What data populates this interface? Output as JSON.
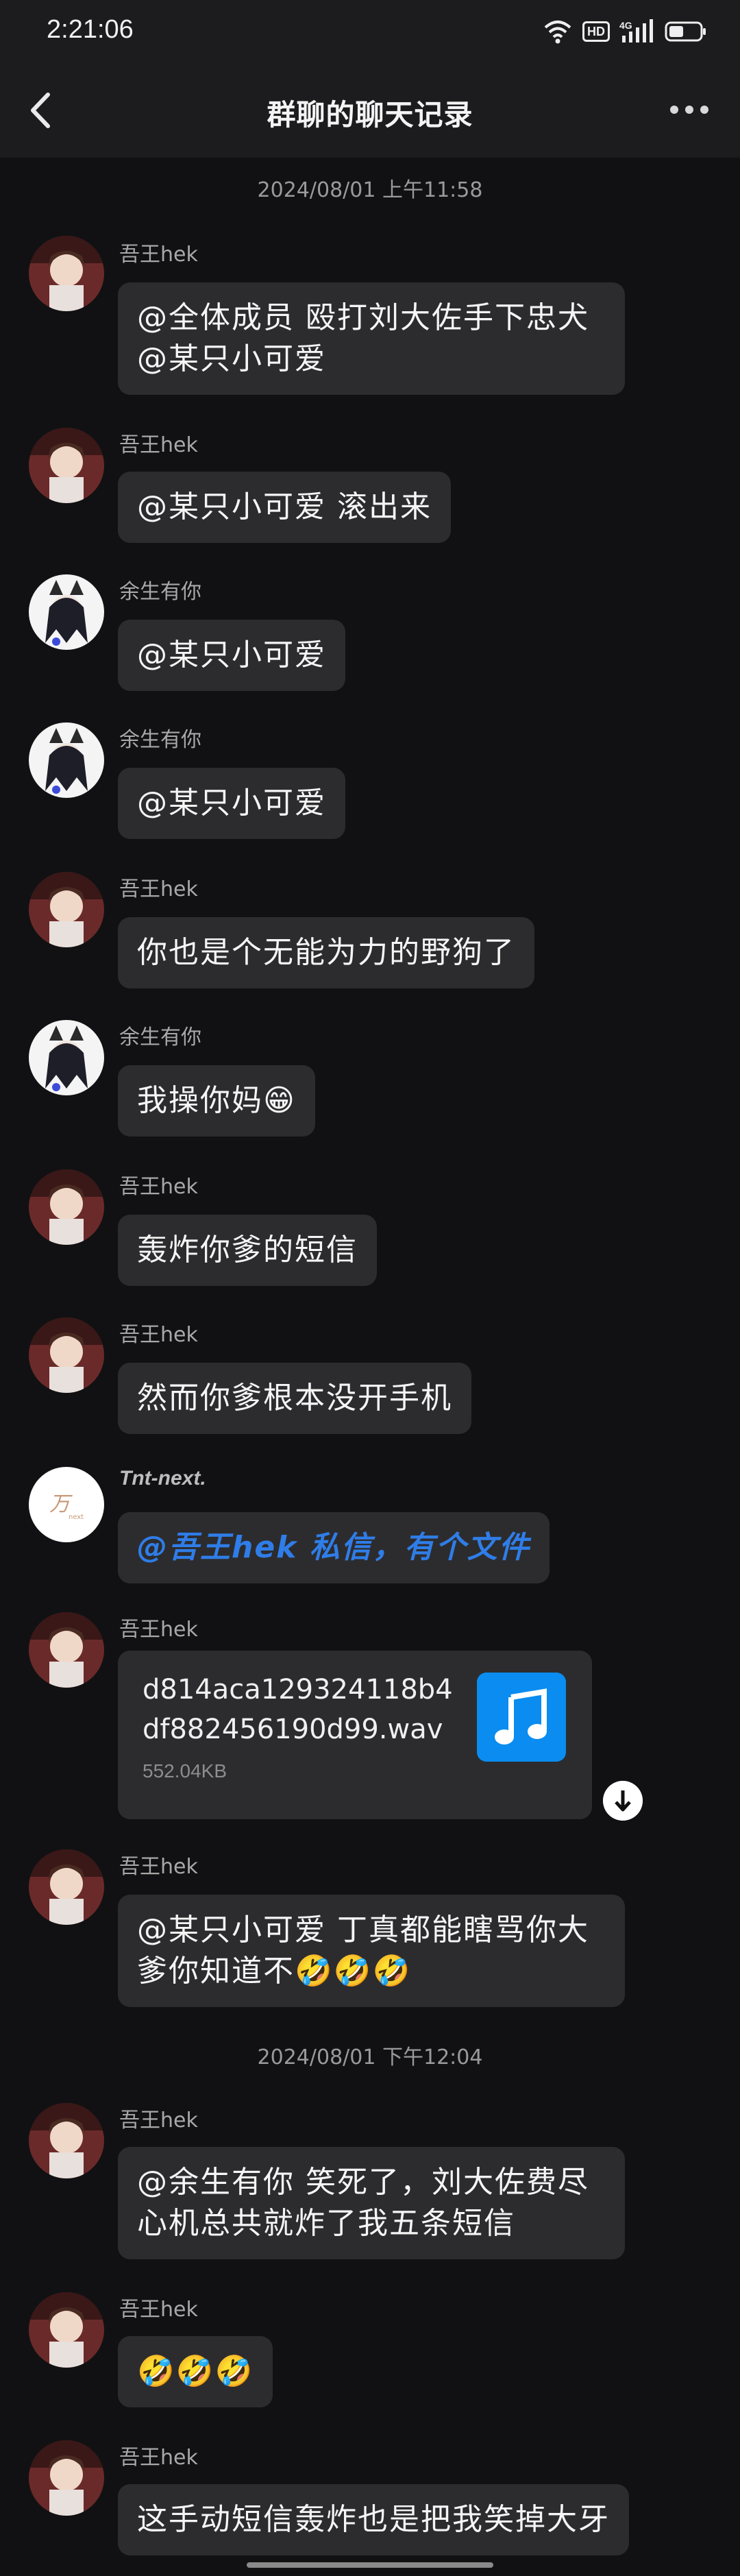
{
  "status_bar": {
    "time": "2:21:06",
    "hd_label": "HD",
    "network_label": "4G"
  },
  "nav": {
    "title": "群聊的聊天记录"
  },
  "timestamps": [
    "2024/08/01 上午11:58",
    "2024/08/01 下午12:04"
  ],
  "messages": [
    {
      "sender": "吾王hek",
      "text": "@全体成员 殴打刘大佐手下忠犬@某只小可爱"
    },
    {
      "sender": "吾王hek",
      "text": "@某只小可爱 滚出来"
    },
    {
      "sender": "余生有你",
      "text": "@某只小可爱"
    },
    {
      "sender": "余生有你",
      "text": "@某只小可爱"
    },
    {
      "sender": "吾王hek",
      "text": "你也是个无能为力的野狗了"
    },
    {
      "sender": "余生有你",
      "text": "我操你妈😁"
    },
    {
      "sender": "吾王hek",
      "text": "轰炸你爹的短信"
    },
    {
      "sender": "吾王hek",
      "text": "然而你爹根本没开手机"
    },
    {
      "sender": "Tnt-next.",
      "text": "@吾王hek 私信，有个文件"
    },
    {
      "sender": "吾王hek",
      "file_name": "d814aca129324118b4df882456190d99.wav",
      "file_size": "552.04KB"
    },
    {
      "sender": "吾王hek",
      "text": "@某只小可爱 丁真都能瞎骂你大爹你知道不🤣🤣🤣"
    },
    {
      "sender": "吾王hek",
      "text": "@余生有你 笑死了，刘大佐费尽心机总共就炸了我五条短信"
    },
    {
      "sender": "吾王hek",
      "text": "🤣🤣🤣"
    },
    {
      "sender": "吾王hek",
      "text": "这手动短信轰炸也是把我笑掉大牙"
    }
  ],
  "colors": {
    "background": "#111113",
    "bubble": "#2c2c2e",
    "link": "#2f7de8",
    "file_icon": "#0a8cf0"
  },
  "icons": {
    "back": "chevron-left-icon",
    "more": "more-dots-icon",
    "file": "music-note-icon",
    "download": "download-arrow-icon"
  }
}
